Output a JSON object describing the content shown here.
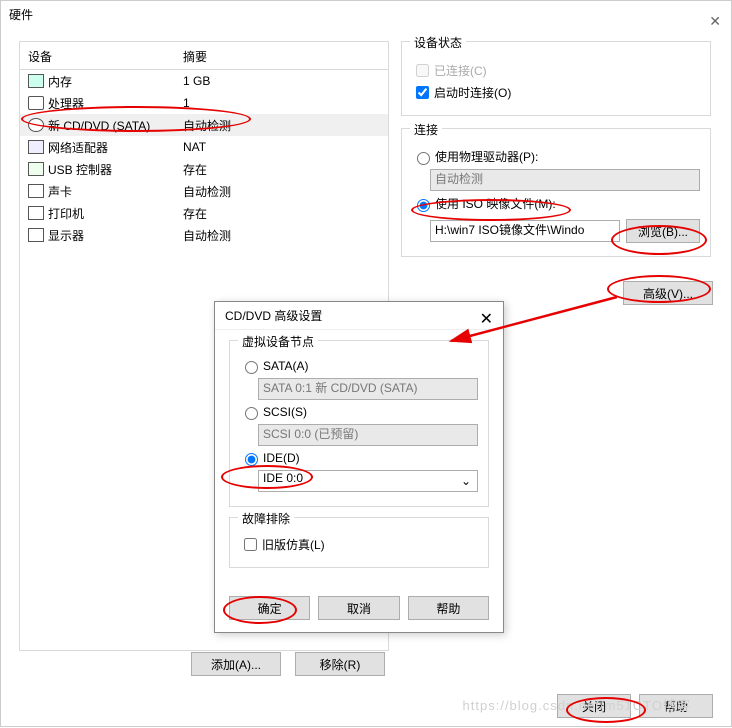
{
  "window": {
    "title": "硬件",
    "close": "✕"
  },
  "left": {
    "header_device": "设备",
    "header_summary": "摘要",
    "rows": [
      {
        "name": "内存",
        "summary": "1 GB"
      },
      {
        "name": "处理器",
        "summary": "1"
      },
      {
        "name": "新 CD/DVD (SATA)",
        "summary": "自动检测"
      },
      {
        "name": "网络适配器",
        "summary": "NAT"
      },
      {
        "name": "USB 控制器",
        "summary": "存在"
      },
      {
        "name": "声卡",
        "summary": "自动检测"
      },
      {
        "name": "打印机",
        "summary": "存在"
      },
      {
        "name": "显示器",
        "summary": "自动检测"
      }
    ]
  },
  "status": {
    "title": "设备状态",
    "connected": "已连接(C)",
    "connect_on_power": "启动时连接(O)"
  },
  "connection": {
    "title": "连接",
    "use_physical": "使用物理驱动器(P):",
    "physical_value": "自动检测",
    "use_iso": "使用 ISO 映像文件(M):",
    "iso_value": "H:\\win7 ISO镜像文件\\Windo",
    "browse": "浏览(B)..."
  },
  "advanced": "高级(V)...",
  "sub": {
    "title": "CD/DVD 高级设置",
    "close": "✕",
    "node_title": "虚拟设备节点",
    "sata_label": "SATA(A)",
    "sata_value": "SATA 0:1   新 CD/DVD (SATA)",
    "scsi_label": "SCSI(S)",
    "scsi_value": "SCSI 0:0   (已预留)",
    "ide_label": "IDE(D)",
    "ide_value": "IDE 0:0",
    "fault_title": "故障排除",
    "legacy": "旧版仿真(L)",
    "ok": "确定",
    "cancel": "取消",
    "help": "帮助"
  },
  "bottom": {
    "add": "添加(A)...",
    "remove": "移除(R)"
  },
  "footer": {
    "close": "关闭",
    "help": "帮助"
  },
  "watermark": "https://blog.csdn.net/m51CTO博客"
}
